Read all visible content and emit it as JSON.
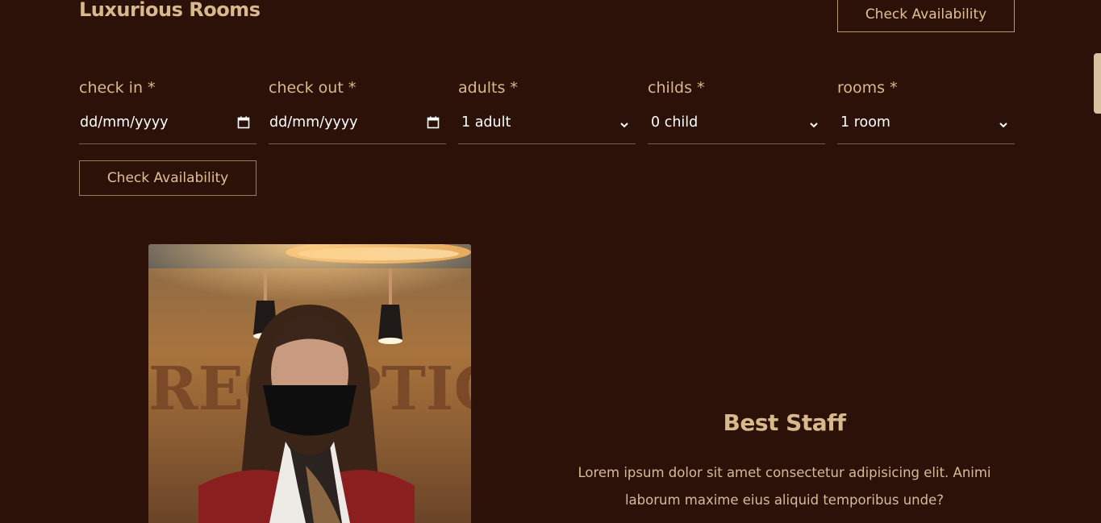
{
  "section": {
    "title": "Luxurious Rooms",
    "top_button_label": "Check Availability"
  },
  "booking_form": {
    "fields": [
      {
        "label": "check in *",
        "value": "dd/mm/yyyy",
        "type": "date"
      },
      {
        "label": "check out *",
        "value": "dd/mm/yyyy",
        "type": "date"
      },
      {
        "label": "adults *",
        "value": "1 adult",
        "type": "select"
      },
      {
        "label": "childs *",
        "value": "0 child",
        "type": "select"
      },
      {
        "label": "rooms *",
        "value": "1 room",
        "type": "select"
      }
    ],
    "submit_label": "Check Availability"
  },
  "staff": {
    "title": "Best Staff",
    "description": "Lorem ipsum dolor sit amet consectetur adipisicing elit. Animi laborum maxime eius aliquid temporibus unde?",
    "photo_text": "RECEPTION"
  },
  "colors": {
    "background": "#2b1107",
    "accent": "#d8b98c"
  },
  "icons": {
    "date": "calendar-icon",
    "select": "chevron-down-icon"
  }
}
